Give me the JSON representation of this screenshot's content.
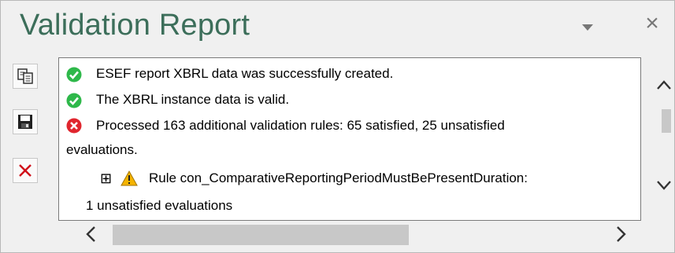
{
  "panel": {
    "title": "Validation Report",
    "dropdown_icon": "triangle-down-icon",
    "close_label": "×"
  },
  "toolbar": {
    "buttons": [
      {
        "name": "copy-button",
        "icon": "copy-icon"
      },
      {
        "name": "save-button",
        "icon": "floppy-disk-icon"
      },
      {
        "name": "clear-button",
        "icon": "red-x-icon"
      }
    ]
  },
  "messages": {
    "line1": {
      "status": "success",
      "text": "ESEF report XBRL data was successfully created."
    },
    "line2": {
      "status": "success",
      "text": "The XBRL instance data is valid."
    },
    "line3": {
      "status": "error",
      "text": "Processed 163 additional validation rules: 65 satisfied, 25 unsatisfied",
      "continuation": "evaluations."
    },
    "line4": {
      "status": "warning",
      "expander": "⊞",
      "text": "Rule con_ComparativeReportingPeriodMustBePresentDuration:",
      "continuation": "1 unsatisfied evaluations"
    }
  },
  "colors": {
    "title": "#3c6e5a",
    "success": "#2eb84a",
    "error": "#e0262e",
    "warning": "#f5b400"
  }
}
